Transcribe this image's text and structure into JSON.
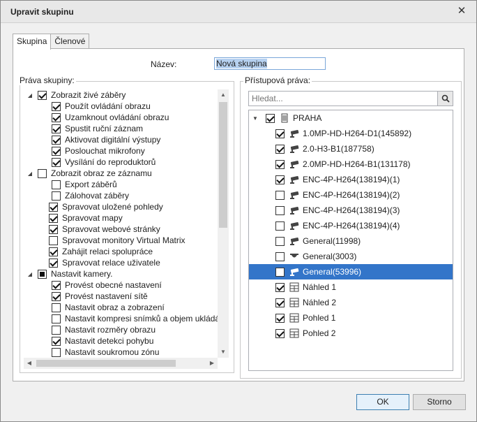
{
  "window": {
    "title": "Upravit skupinu"
  },
  "tabs": [
    {
      "label": "Skupina"
    },
    {
      "label": "Členové"
    }
  ],
  "name_field": {
    "label": "Název:",
    "value": "Nová skupina"
  },
  "rights": {
    "label": "Práva skupiny:",
    "items": [
      {
        "label": "Zobrazit živé záběry",
        "level": 0,
        "state": "checked",
        "expander": "expanded"
      },
      {
        "label": "Použít ovládání obrazu",
        "level": 1,
        "state": "checked"
      },
      {
        "label": "Uzamknout ovládání obrazu",
        "level": 1,
        "state": "checked"
      },
      {
        "label": "Spustit ruční záznam",
        "level": 1,
        "state": "checked"
      },
      {
        "label": "Aktivovat digitální výstupy",
        "level": 1,
        "state": "checked"
      },
      {
        "label": "Poslouchat mikrofony",
        "level": 1,
        "state": "checked"
      },
      {
        "label": "Vysílání do reproduktorů",
        "level": 1,
        "state": "checked"
      },
      {
        "label": "Zobrazit obraz ze záznamu",
        "level": 0,
        "state": "unchecked",
        "expander": "expanded"
      },
      {
        "label": "Export záběrů",
        "level": 1,
        "state": "unchecked"
      },
      {
        "label": "Zálohovat záběry",
        "level": 1,
        "state": "unchecked"
      },
      {
        "label": "Spravovat uložené pohledy",
        "level": 0,
        "state": "checked"
      },
      {
        "label": "Spravovat mapy",
        "level": 0,
        "state": "checked"
      },
      {
        "label": "Spravovat webové stránky",
        "level": 0,
        "state": "checked"
      },
      {
        "label": "Spravovat monitory Virtual Matrix",
        "level": 0,
        "state": "unchecked"
      },
      {
        "label": "Zahájit relaci spolupráce",
        "level": 0,
        "state": "checked"
      },
      {
        "label": "Spravovat relace uživatele",
        "level": 0,
        "state": "checked"
      },
      {
        "label": "Nastavit kamery.",
        "level": 0,
        "state": "partial",
        "expander": "expanded"
      },
      {
        "label": "Provést obecné nastavení",
        "level": 1,
        "state": "checked"
      },
      {
        "label": "Provést nastavení sítě",
        "level": 1,
        "state": "checked"
      },
      {
        "label": "Nastavit obraz a zobrazení",
        "level": 1,
        "state": "unchecked"
      },
      {
        "label": "Nastavit kompresi snímků a objem ukládá",
        "level": 1,
        "state": "unchecked"
      },
      {
        "label": "Nastavit rozměry obrazu",
        "level": 1,
        "state": "unchecked"
      },
      {
        "label": "Nastavit detekci pohybu",
        "level": 1,
        "state": "checked"
      },
      {
        "label": "Nastavit soukromou zónu",
        "level": 1,
        "state": "unchecked"
      }
    ]
  },
  "access": {
    "label": "Přístupová práva:",
    "search_placeholder": "Hledat...",
    "tree": [
      {
        "label": "PRAHA",
        "level": 0,
        "state": "checked",
        "icon": "server-icon",
        "expander": "expanded"
      },
      {
        "label": "1.0MP-HD-H264-D1(145892)",
        "level": 1,
        "state": "checked",
        "icon": "camera-icon"
      },
      {
        "label": "2.0-H3-B1(187758)",
        "level": 1,
        "state": "checked",
        "icon": "camera-icon"
      },
      {
        "label": "2.0MP-HD-H264-B1(131178)",
        "level": 1,
        "state": "checked",
        "icon": "camera-icon"
      },
      {
        "label": "ENC-4P-H264(138194)(1)",
        "level": 1,
        "state": "checked",
        "icon": "camera-icon"
      },
      {
        "label": "ENC-4P-H264(138194)(2)",
        "level": 1,
        "state": "unchecked",
        "icon": "camera-icon"
      },
      {
        "label": "ENC-4P-H264(138194)(3)",
        "level": 1,
        "state": "unchecked",
        "icon": "camera-icon"
      },
      {
        "label": "ENC-4P-H264(138194)(4)",
        "level": 1,
        "state": "unchecked",
        "icon": "camera-icon"
      },
      {
        "label": "General(11998)",
        "level": 1,
        "state": "unchecked",
        "icon": "camera-icon"
      },
      {
        "label": "General(3003)",
        "level": 1,
        "state": "unchecked",
        "icon": "dome-camera-icon"
      },
      {
        "label": "General(53996)",
        "level": 1,
        "state": "unchecked",
        "icon": "camera-icon",
        "selected": true
      },
      {
        "label": "Náhled 1",
        "level": 1,
        "state": "checked",
        "icon": "view-icon"
      },
      {
        "label": "Náhled 2",
        "level": 1,
        "state": "checked",
        "icon": "view-icon"
      },
      {
        "label": "Pohled 1",
        "level": 1,
        "state": "checked",
        "icon": "view-icon"
      },
      {
        "label": "Pohled 2",
        "level": 1,
        "state": "checked",
        "icon": "view-icon"
      }
    ]
  },
  "buttons": {
    "ok": "OK",
    "cancel": "Storno"
  },
  "colors": {
    "selection": "#3375c9",
    "accent_border": "#3c7fb1"
  }
}
